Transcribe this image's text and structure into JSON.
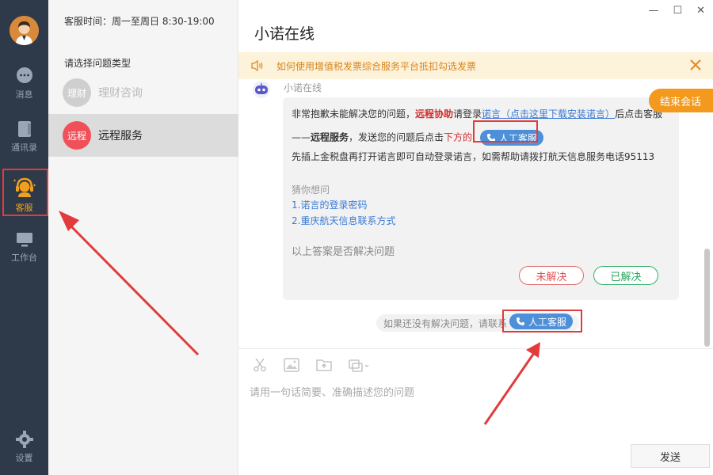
{
  "nav": {
    "items": [
      {
        "label": "消息",
        "icon": "message-icon"
      },
      {
        "label": "通讯录",
        "icon": "contacts-icon"
      },
      {
        "label": "客服",
        "icon": "customer-service-icon",
        "active": true
      },
      {
        "label": "工作台",
        "icon": "workbench-icon"
      }
    ],
    "settings_label": "设置"
  },
  "panel": {
    "service_time": "客服时间：周一至周日 8:30-19:00",
    "choose_type": "请选择问题类型",
    "types": [
      {
        "badge": "理财",
        "label": "理财咨询",
        "color": "#cfcfcf"
      },
      {
        "badge": "远程",
        "label": "远程服务",
        "color": "#f0505a"
      }
    ]
  },
  "chat": {
    "title": "小诺在线",
    "notice": "如何使用增值税发票综合服务平台抵扣勾选发票",
    "bot_name": "小诺在线",
    "end_chat": "结束会话",
    "message": {
      "l1_a": "非常抱歉未能解决您的问题，",
      "l1_b": "远程协助",
      "l1_c": "请登录",
      "l1_d": "诺言（点击这里下载安装诺言）",
      "l1_e": "后点击客服",
      "l2_a": "——",
      "l2_b": "远程服务",
      "l2_c": "，发送您的问题后点击",
      "l2_d": "下方的",
      "l3": "先插上金税盘再打开诺言即可自动登录诺言，如需帮助请拨打航天信息服务电话95113",
      "guess_title": "猜你想问",
      "guess_1": "1.诺言的登录密码",
      "guess_2": "2.重庆航天信息联系方式",
      "solved_q": "以上答案是否解决问题"
    },
    "pill_label": "人工客服",
    "unsolved": "未解决",
    "solved": "已解决",
    "hint": "如果还没有解决问题，请联系",
    "input_placeholder": "请用一句话简要、准确描述您的问题",
    "send": "发送"
  },
  "colors": {
    "accent": "#f39a1e",
    "nav_bg": "#2e3a4a",
    "annotation_red": "#e23b3b",
    "link": "#3a7bd5"
  }
}
